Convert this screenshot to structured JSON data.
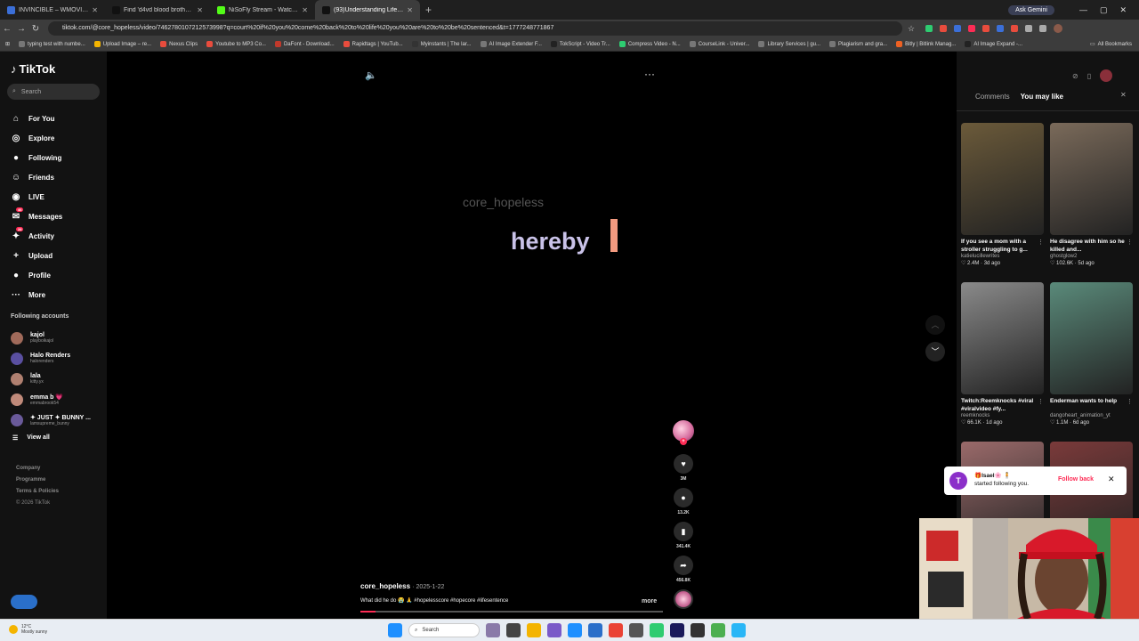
{
  "browser": {
    "tabs": [
      {
        "title": "INVINCIBLE – WMOVIES",
        "color": "#3b6fd8",
        "active": false
      },
      {
        "title": "Find 'd4vd blood brother story'",
        "color": "#111111",
        "active": false
      },
      {
        "title": "NiSoFly Stream - Watch Live on",
        "color": "#53fc18",
        "active": false
      },
      {
        "title": "(93)Understanding Life Sen",
        "color": "#111111",
        "active": true
      }
    ],
    "gemini_label": "Ask Gemini",
    "url": "tiktok.com/@core_hopeless/video/7462780107212573998?q=court%20if%20you%20come%20back%20to%20life%20you%20are%20to%20be%20sentenced&t=1777248771867",
    "bookmarks": [
      {
        "label": "typing test with numbe...",
        "color": "#777777"
      },
      {
        "label": "Upload Image – re...",
        "color": "#f4b400"
      },
      {
        "label": "Nexus Clips",
        "color": "#e84c3d"
      },
      {
        "label": "Youtube to MP3 Co...",
        "color": "#e84c3d"
      },
      {
        "label": "DaFont - Download...",
        "color": "#c0392b"
      },
      {
        "label": "Rapidtags | YouTub...",
        "color": "#e84c3d"
      },
      {
        "label": "Myinstants | The lar...",
        "color": "#333333"
      },
      {
        "label": "AI Image Extender F...",
        "color": "#777777"
      },
      {
        "label": "TokScript - Video Tr...",
        "color": "#222222"
      },
      {
        "label": "Compress Video - N...",
        "color": "#2ecc71"
      },
      {
        "label": "CourseLink - Univer...",
        "color": "#777777"
      },
      {
        "label": "Library Services | gu...",
        "color": "#777777"
      },
      {
        "label": "Plagiarism and gra...",
        "color": "#777777"
      },
      {
        "label": "Bitly | Bitlink Manag...",
        "color": "#ee6123"
      },
      {
        "label": "AI Image Expand -...",
        "color": "#222222"
      }
    ],
    "all_bookmarks": "All Bookmarks"
  },
  "sidebar": {
    "logo": "TikTok",
    "search_placeholder": "Search",
    "nav": [
      {
        "label": "For You",
        "icon": "home-icon",
        "glyph": "⌂"
      },
      {
        "label": "Explore",
        "icon": "compass-icon",
        "glyph": "◎"
      },
      {
        "label": "Following",
        "icon": "following-icon",
        "glyph": "●"
      },
      {
        "label": "Friends",
        "icon": "friends-icon",
        "glyph": "☺"
      },
      {
        "label": "LIVE",
        "icon": "live-icon",
        "glyph": "◉"
      },
      {
        "label": "Messages",
        "icon": "messages-icon",
        "glyph": "✉",
        "badge": "46"
      },
      {
        "label": "Activity",
        "icon": "activity-icon",
        "glyph": "✦",
        "badge": "28"
      },
      {
        "label": "Upload",
        "icon": "upload-icon",
        "glyph": "+"
      },
      {
        "label": "Profile",
        "icon": "profile-icon",
        "glyph": "●"
      },
      {
        "label": "More",
        "icon": "more-icon",
        "glyph": "···"
      }
    ],
    "following_header": "Following accounts",
    "following": [
      {
        "name": "kajol",
        "handle": "playboikajol",
        "color": "#a06a5a"
      },
      {
        "name": "Halo Renders",
        "handle": "halorenders",
        "color": "#5a4fa0"
      },
      {
        "name": "lala",
        "handle": "kitty.yx",
        "color": "#b08070"
      },
      {
        "name": "emma b 💗",
        "handle": "emmabrook54",
        "color": "#c08a7a"
      },
      {
        "name": "✦ JUST ✦ BUNNY ...",
        "handle": "lamsupreme_bunny",
        "color": "#6a5a9a"
      }
    ],
    "view_all": "View all",
    "footer": [
      "Company",
      "Programme",
      "Terms & Policies"
    ],
    "copyright": "© 2026 TikTok"
  },
  "video": {
    "watermark": "core_hopeless",
    "overlay_text": "hereby",
    "author": "core_hopeless",
    "date": "· 2025-1-22",
    "caption": "What did he do 😭 🙏 #hopelesscore #hopecore #lifesentence",
    "more": "more",
    "progress": 0.05,
    "actions": {
      "likes": "3M",
      "comments": "13.2K",
      "saves": "341.4K",
      "shares": "456.8K"
    }
  },
  "right_panel": {
    "tabs": [
      "Comments",
      "You may like"
    ],
    "active_tab": "You may like",
    "cards": [
      {
        "title": "If you see a mom with a stroller struggling to g...",
        "author": "katielucillewrites",
        "stats": "♡ 2.4M · 3d ago",
        "thumb": "#6b5a3a"
      },
      {
        "title": "He disagree with him so he killed and...",
        "author": "ghostglow2",
        "stats": "♡ 102.6K · 5d ago",
        "thumb": "#7a6a5a"
      },
      {
        "title": "Twitch:Reemknocks #viral #viralvideo #fy...",
        "author": "reemknocks",
        "stats": "♡ 66.1K · 1d ago",
        "thumb": "#8a8a8a"
      },
      {
        "title": "Enderman wants to help",
        "author": "dangoheart_animation_yt",
        "stats": "♡ 1.1M · 6d ago",
        "thumb": "#5a8a7a"
      },
      {
        "title": "",
        "author": "",
        "stats": "",
        "thumb": "#9a6a6a"
      },
      {
        "title": "",
        "author": "",
        "stats": "",
        "thumb": "#7a3a3a"
      }
    ]
  },
  "notification": {
    "initial": "T",
    "name": "🎁Isael🌸 🧍",
    "text": "started following you.",
    "action": "Follow back"
  },
  "taskbar": {
    "temp": "12°C",
    "weather": "Mostly sunny",
    "search": "Search"
  }
}
